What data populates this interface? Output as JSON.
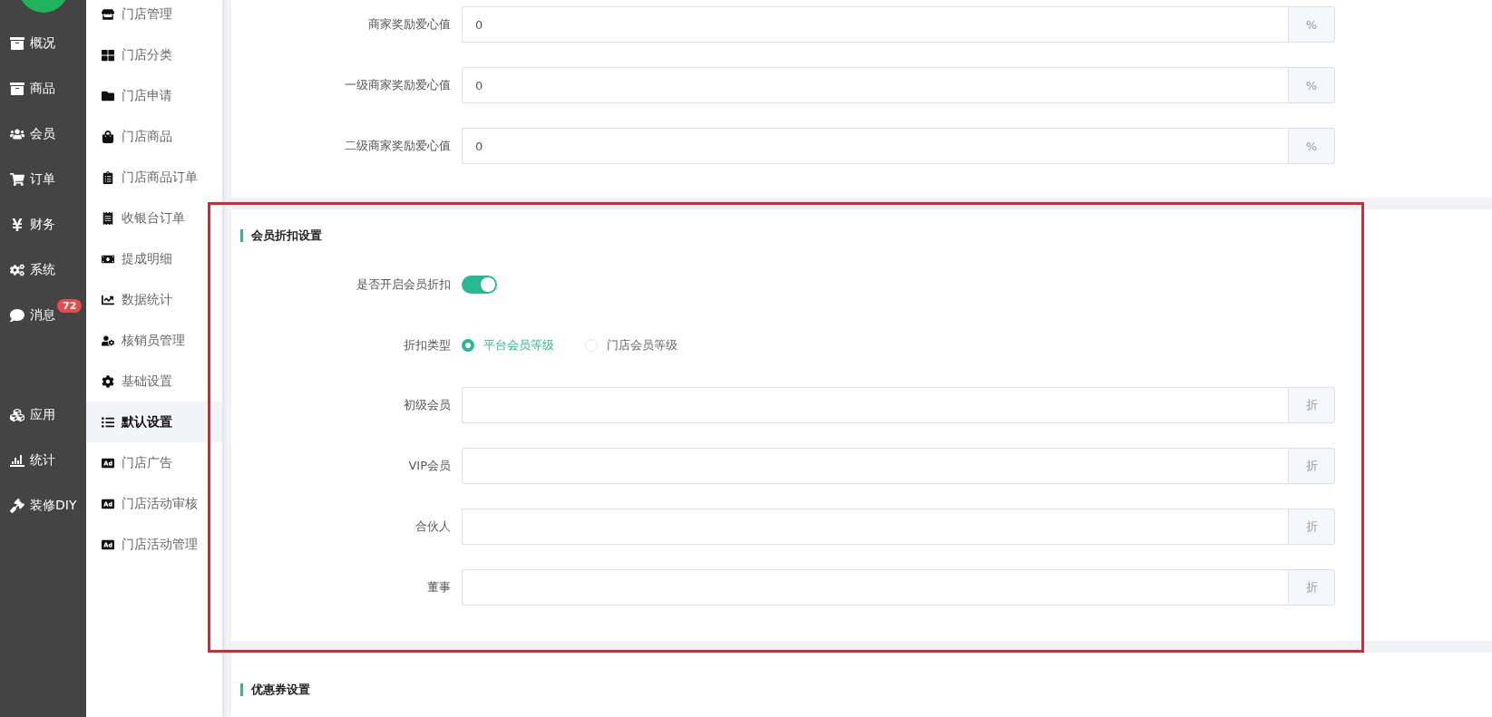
{
  "nav": {
    "items": [
      {
        "label": "概况",
        "selected": false
      },
      {
        "label": "商品",
        "selected": false
      },
      {
        "label": "会员",
        "selected": false
      },
      {
        "label": "订单",
        "selected": false
      },
      {
        "label": "财务",
        "selected": false
      },
      {
        "label": "系统",
        "selected": false
      },
      {
        "label": "消息",
        "selected": false,
        "badge": "72"
      },
      {
        "label": "应用",
        "selected": false
      },
      {
        "label": "统计",
        "selected": false
      },
      {
        "label": "装修DIY",
        "selected": false
      }
    ]
  },
  "subnav": {
    "items": [
      {
        "label": "门店管理",
        "selected": false
      },
      {
        "label": "门店分类",
        "selected": false
      },
      {
        "label": "门店申请",
        "selected": false
      },
      {
        "label": "门店商品",
        "selected": false
      },
      {
        "label": "门店商品订单",
        "selected": false
      },
      {
        "label": "收银台订单",
        "selected": false
      },
      {
        "label": "提成明细",
        "selected": false
      },
      {
        "label": "数据统计",
        "selected": false
      },
      {
        "label": "核销员管理",
        "selected": false
      },
      {
        "label": "基础设置",
        "selected": false
      },
      {
        "label": "默认设置",
        "selected": true
      },
      {
        "label": "门店广告",
        "selected": false
      },
      {
        "label": "门店活动审核",
        "selected": false
      },
      {
        "label": "门店活动管理",
        "selected": false
      }
    ]
  },
  "reward_fields": [
    {
      "label": "商家奖励爱心值",
      "value": "0",
      "unit": "%"
    },
    {
      "label": "一级商家奖励爱心值",
      "value": "0",
      "unit": "%"
    },
    {
      "label": "二级商家奖励爱心值",
      "value": "0",
      "unit": "%"
    }
  ],
  "member_discount": {
    "title": "会员折扣设置",
    "enable_label": "是否开启会员折扣",
    "enabled": true,
    "type_label": "折扣类型",
    "type_options": [
      {
        "label": "平台会员等级",
        "selected": true
      },
      {
        "label": "门店会员等级",
        "selected": false
      }
    ],
    "levels": [
      {
        "label": "初级会员",
        "unit": "折"
      },
      {
        "label": "VIP会员",
        "unit": "折"
      },
      {
        "label": "合伙人",
        "unit": "折"
      },
      {
        "label": "董事",
        "unit": "折"
      }
    ]
  },
  "coupon": {
    "title": "优惠券设置"
  }
}
